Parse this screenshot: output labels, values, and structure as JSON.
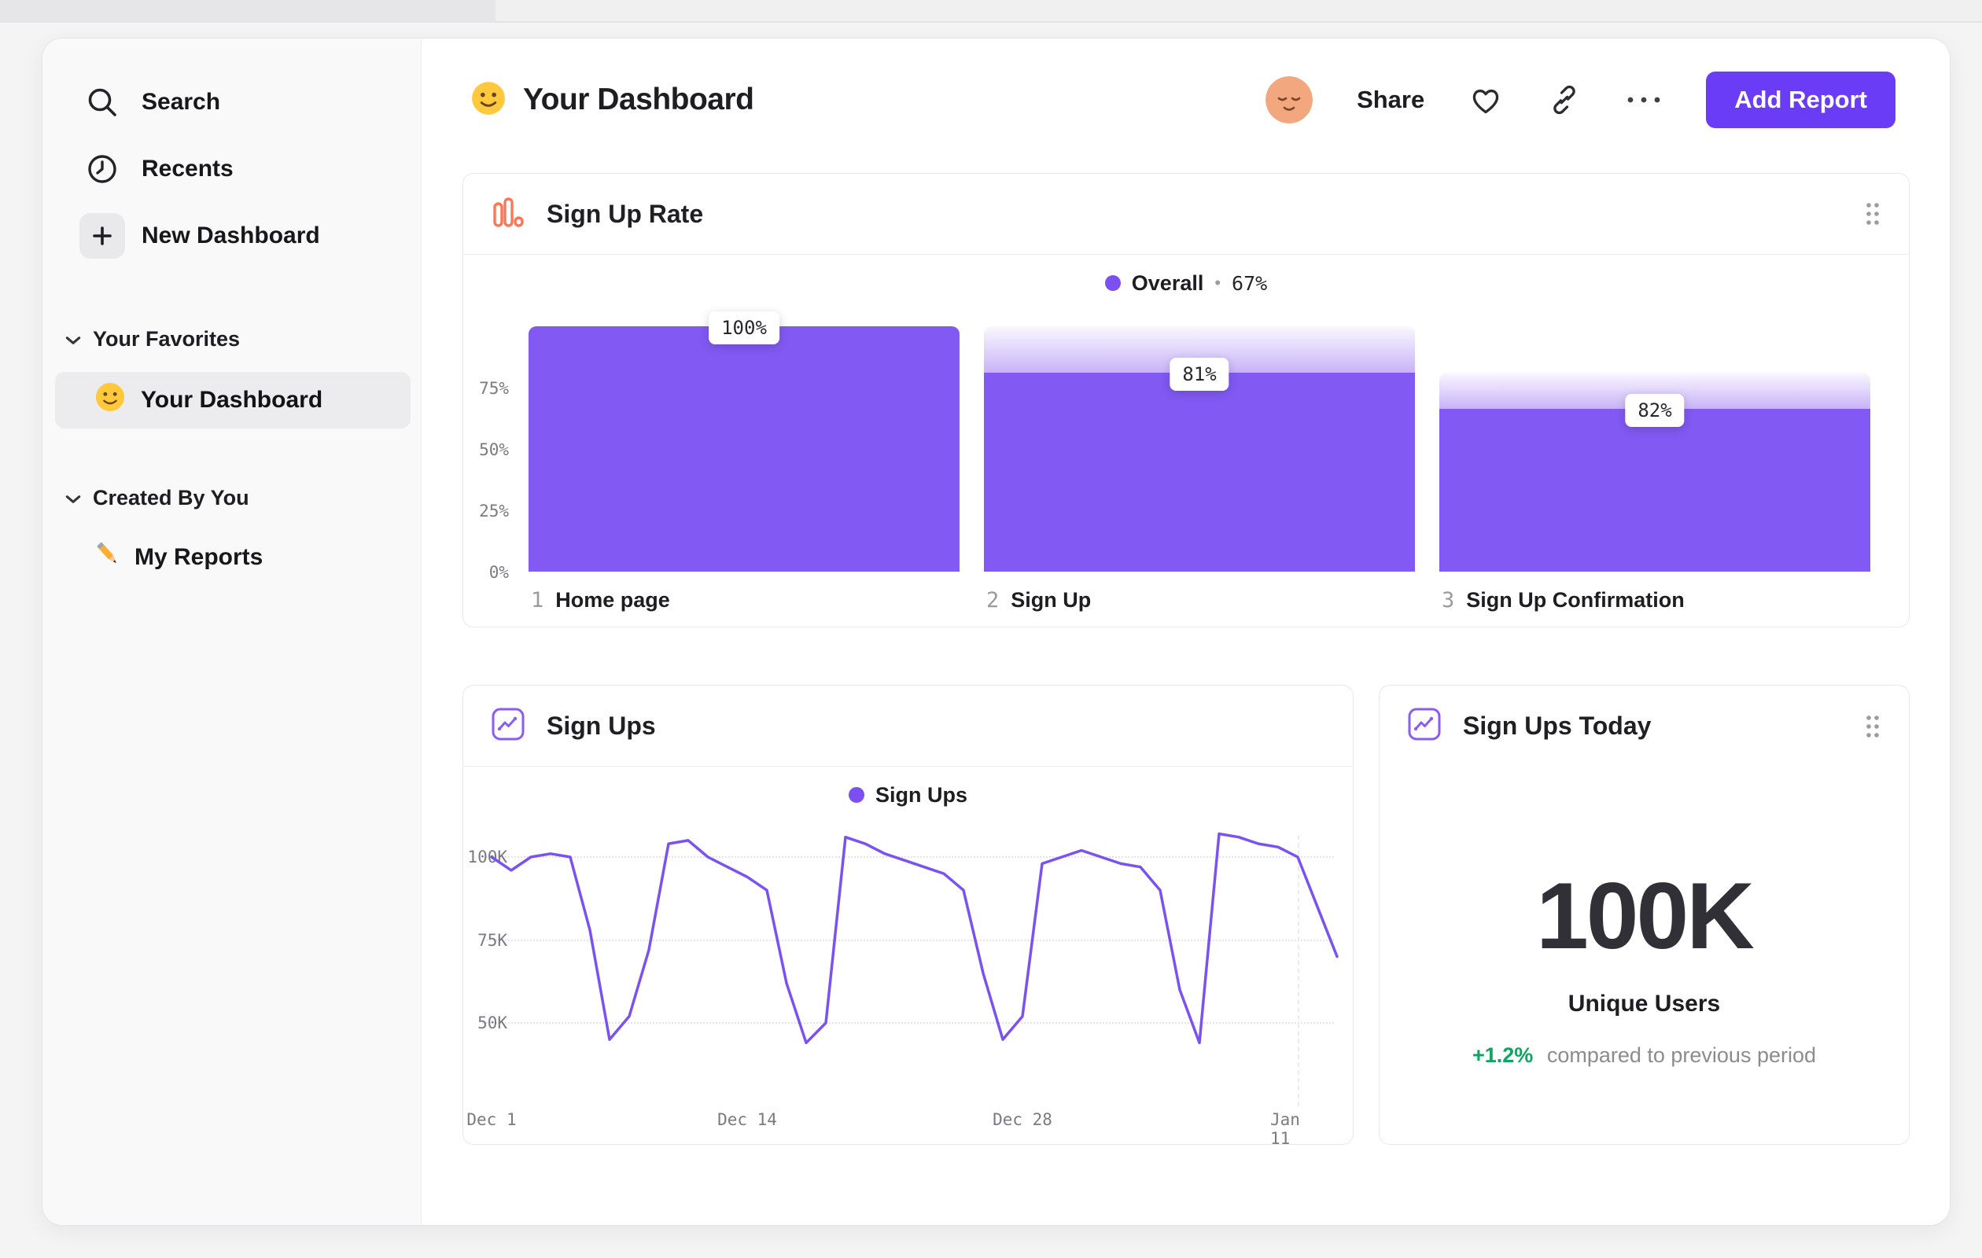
{
  "sidebar": {
    "items": [
      {
        "label": "Search"
      },
      {
        "label": "Recents"
      },
      {
        "label": "New Dashboard"
      }
    ],
    "sections": [
      {
        "label": "Your Favorites",
        "items": [
          {
            "label": "Your Dashboard"
          }
        ]
      },
      {
        "label": "Created By You",
        "items": [
          {
            "label": "My Reports"
          }
        ]
      }
    ]
  },
  "header": {
    "title": "Your Dashboard",
    "share_label": "Share",
    "add_report_label": "Add Report"
  },
  "colors": {
    "accent_purple": "#7C4FF0",
    "bar_purple": "#8259F3",
    "button_purple": "#6B3CF5",
    "orange": "#FF7557",
    "green": "#0FA45F"
  },
  "cards": {
    "funnel": {
      "title": "Sign Up Rate",
      "legend": {
        "name": "Overall",
        "separator": "•",
        "value": "67%"
      },
      "y_ticks": [
        "75%",
        "50%",
        "25%",
        "0%"
      ],
      "steps": [
        {
          "index": "1",
          "name": "Home page",
          "badge": "100%",
          "fill_pct": 100,
          "prev_pct": 100
        },
        {
          "index": "2",
          "name": "Sign Up",
          "badge": "81%",
          "fill_pct": 81,
          "prev_pct": 100
        },
        {
          "index": "3",
          "name": "Sign Up Confirmation",
          "badge": "82%",
          "fill_pct": 66.4,
          "prev_pct": 81
        }
      ]
    },
    "line": {
      "title": "Sign Ups",
      "legend": "Sign Ups",
      "type": "line",
      "y_ticks": [
        {
          "label": "100K",
          "value": 100
        },
        {
          "label": "75K",
          "value": 75
        },
        {
          "label": "50K",
          "value": 50
        }
      ],
      "x_ticks": [
        {
          "label": "Dec 1",
          "day": 0
        },
        {
          "label": "Dec 14",
          "day": 13
        },
        {
          "label": "Dec 28",
          "day": 27
        },
        {
          "label": "Jan 11",
          "day": 41
        }
      ],
      "values": [
        100,
        96,
        100,
        101,
        100,
        78,
        45,
        52,
        72,
        104,
        105,
        100,
        97,
        94,
        90,
        62,
        44,
        50,
        106,
        104,
        101,
        99,
        97,
        95,
        90,
        65,
        45,
        52,
        98,
        100,
        102,
        100,
        98,
        97,
        90,
        60,
        44,
        107,
        106,
        104,
        103,
        100,
        85,
        70
      ]
    },
    "big_number": {
      "title": "Sign Ups Today",
      "value": "100K",
      "label": "Unique Users",
      "delta": "+1.2%",
      "delta_suffix": "compared to previous period"
    }
  }
}
